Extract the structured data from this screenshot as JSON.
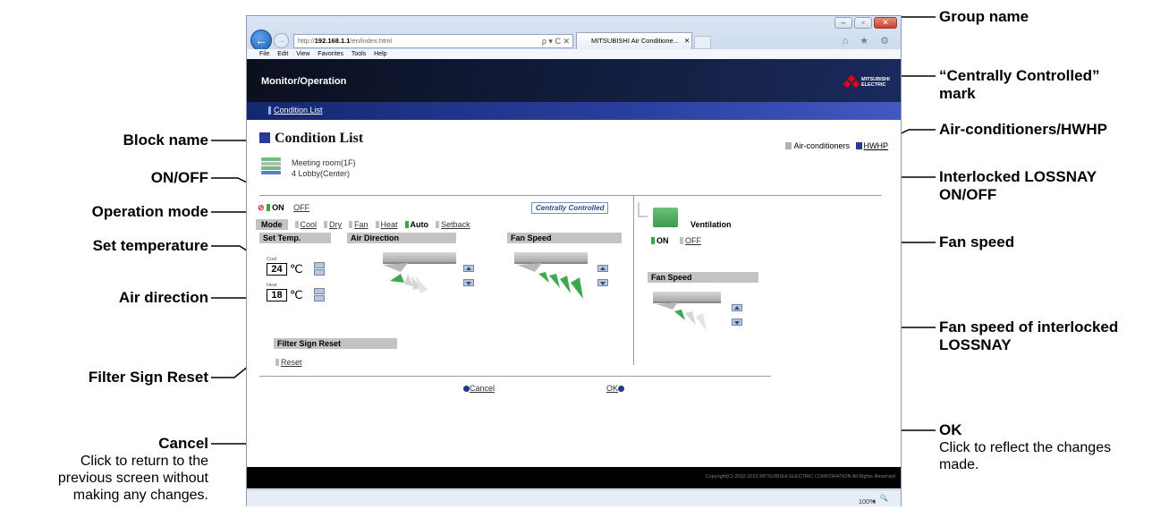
{
  "browser": {
    "address_prefix": "http://",
    "address_host": "192.168.1.1",
    "address_path": "/en/index.html",
    "address_controls": "ρ ▾ C ✕",
    "tab_title": "MITSUBISHI Air Conditione...",
    "tab_close": "✕",
    "tool_icons": "⌂ ★ ⚙",
    "menu": [
      "File",
      "Edit",
      "View",
      "Favorites",
      "Tools",
      "Help"
    ],
    "zoom": "100%",
    "zoom_caret": "▾"
  },
  "app": {
    "banner_title": "Monitor/Operation",
    "brand_text": "MITSUBISHI ELECTRIC",
    "subnav_link": "Condition List",
    "page_title": "Condition List",
    "unit_toggle": {
      "current": "Air-conditioners",
      "other": "HWHP"
    },
    "group": {
      "name": "Meeting room(1F)",
      "block": "4 Lobby(Center)"
    },
    "onoff": {
      "on": "ON",
      "off": "OFF"
    },
    "centrally_controlled": "Centrally Controlled",
    "mode": {
      "label": "Mode",
      "options": [
        "Cool",
        "Dry",
        "Fan",
        "Heat",
        "Auto",
        "Setback"
      ],
      "selected": "Auto"
    },
    "set_temp": {
      "header": "Set Temp.",
      "cool_label": "Cool",
      "cool_value": "24",
      "heat_label": "Heat",
      "heat_value": "18",
      "unit": "℃"
    },
    "air_direction_header": "Air Direction",
    "fan_speed_header": "Fan Speed",
    "filter": {
      "header": "Filter Sign Reset",
      "reset": "Reset"
    },
    "ventilation": {
      "label": "Ventilation",
      "on": "ON",
      "off": "OFF",
      "fan_speed_header": "Fan Speed"
    },
    "cancel": "Cancel",
    "ok": "OK",
    "copyright": "Copyright(C) 2002-2013 MITSUBISHI ELECTRIC CORPORATION All Rights Reserved"
  },
  "callouts": {
    "block_name": "Block name",
    "on_off": "ON/OFF",
    "operation_mode": "Operation mode",
    "set_temperature": "Set temperature",
    "air_direction": "Air direction",
    "filter_sign_reset": "Filter Sign Reset",
    "cancel_title": "Cancel",
    "cancel_desc_1": "Click to return to the",
    "cancel_desc_2": "previous screen without",
    "cancel_desc_3": "making any changes.",
    "group_name": "Group name",
    "centrally_controlled_1": "“Centrally Controlled”",
    "centrally_controlled_2": "mark",
    "air_hwhp": "Air-conditioners/HWHP",
    "interlocked_onoff_1": "Interlocked LOSSNAY",
    "interlocked_onoff_2": "ON/OFF",
    "fan_speed": "Fan speed",
    "fan_speed_lossnay_1": "Fan speed of interlocked",
    "fan_speed_lossnay_2": "LOSSNAY",
    "ok_title": "OK",
    "ok_desc_1": "Click to reflect the changes",
    "ok_desc_2": "made."
  },
  "colors": {
    "banner": "#101a36",
    "subnav": "#2a40a0",
    "accent_green": "#33a844",
    "title_square": "#2a3c92"
  }
}
